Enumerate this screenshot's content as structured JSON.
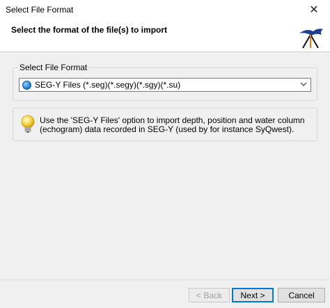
{
  "window": {
    "title": "Select File Format",
    "close_icon": "close-icon"
  },
  "header": {
    "title": "Select the format of the file(s) to import",
    "logo_icon": "tripod-logo-icon"
  },
  "format_group": {
    "legend": "Select File Format",
    "selected_value": "SEG-Y Files (*.seg)(*.segy)(*.sgy)(*.su)",
    "item_icon": "globe-icon"
  },
  "info": {
    "icon": "lightbulb-icon",
    "text": "Use the 'SEG-Y Files' option to import depth, position and water column (echogram) data recorded in SEG-Y (used by for instance SyQwest)."
  },
  "buttons": {
    "back": "< Back",
    "next": "Next >",
    "cancel": "Cancel"
  }
}
